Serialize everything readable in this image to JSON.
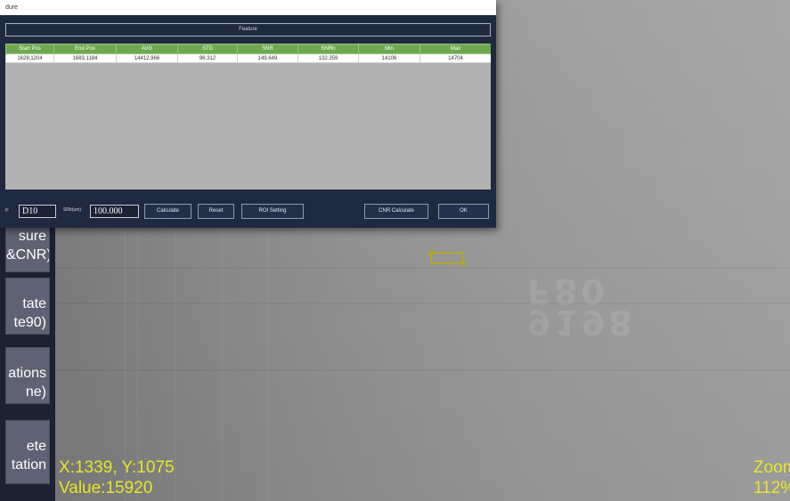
{
  "dialog": {
    "title": "dure",
    "feature_label": "Feature",
    "table": {
      "columns": [
        "Start Pos",
        "End Pos",
        "AVG",
        "STD",
        "SNR",
        "SNRn",
        "Min",
        "Max"
      ],
      "rows": [
        [
          "1628,1204",
          "1683,1184",
          "14412.966",
          "96.312",
          "149.649",
          "132.359",
          "14106",
          "14704"
        ]
      ]
    },
    "footer": {
      "gap_label": "p:",
      "gap_value": "D10",
      "srb_label": "SRb(um)",
      "srb_value": "100.000",
      "calculate_label": "Calculate",
      "reset_label": "Reset",
      "roi_setting_label": "ROI Setting",
      "cnr_calculate_label": "CNR Calculate",
      "ok_label": "OK"
    }
  },
  "side_menu": {
    "items": [
      {
        "label": "sure\n&CNR)"
      },
      {
        "label": "tate\nte90)"
      },
      {
        "label": "ations\nne)"
      },
      {
        "label": "ete\ntation"
      }
    ]
  },
  "viewer": {
    "ghost_text": [
      "F80",
      "9198"
    ],
    "coordinates": "X:1339, Y:1075",
    "value": "Value:15920",
    "zoom_label": "Zoom",
    "zoom_value": "112%"
  },
  "colors": {
    "readout": "#e8e629",
    "table_header": "#6ea94f",
    "dialog_bg": "#1f2a40",
    "menu_button": "#5e6272"
  }
}
